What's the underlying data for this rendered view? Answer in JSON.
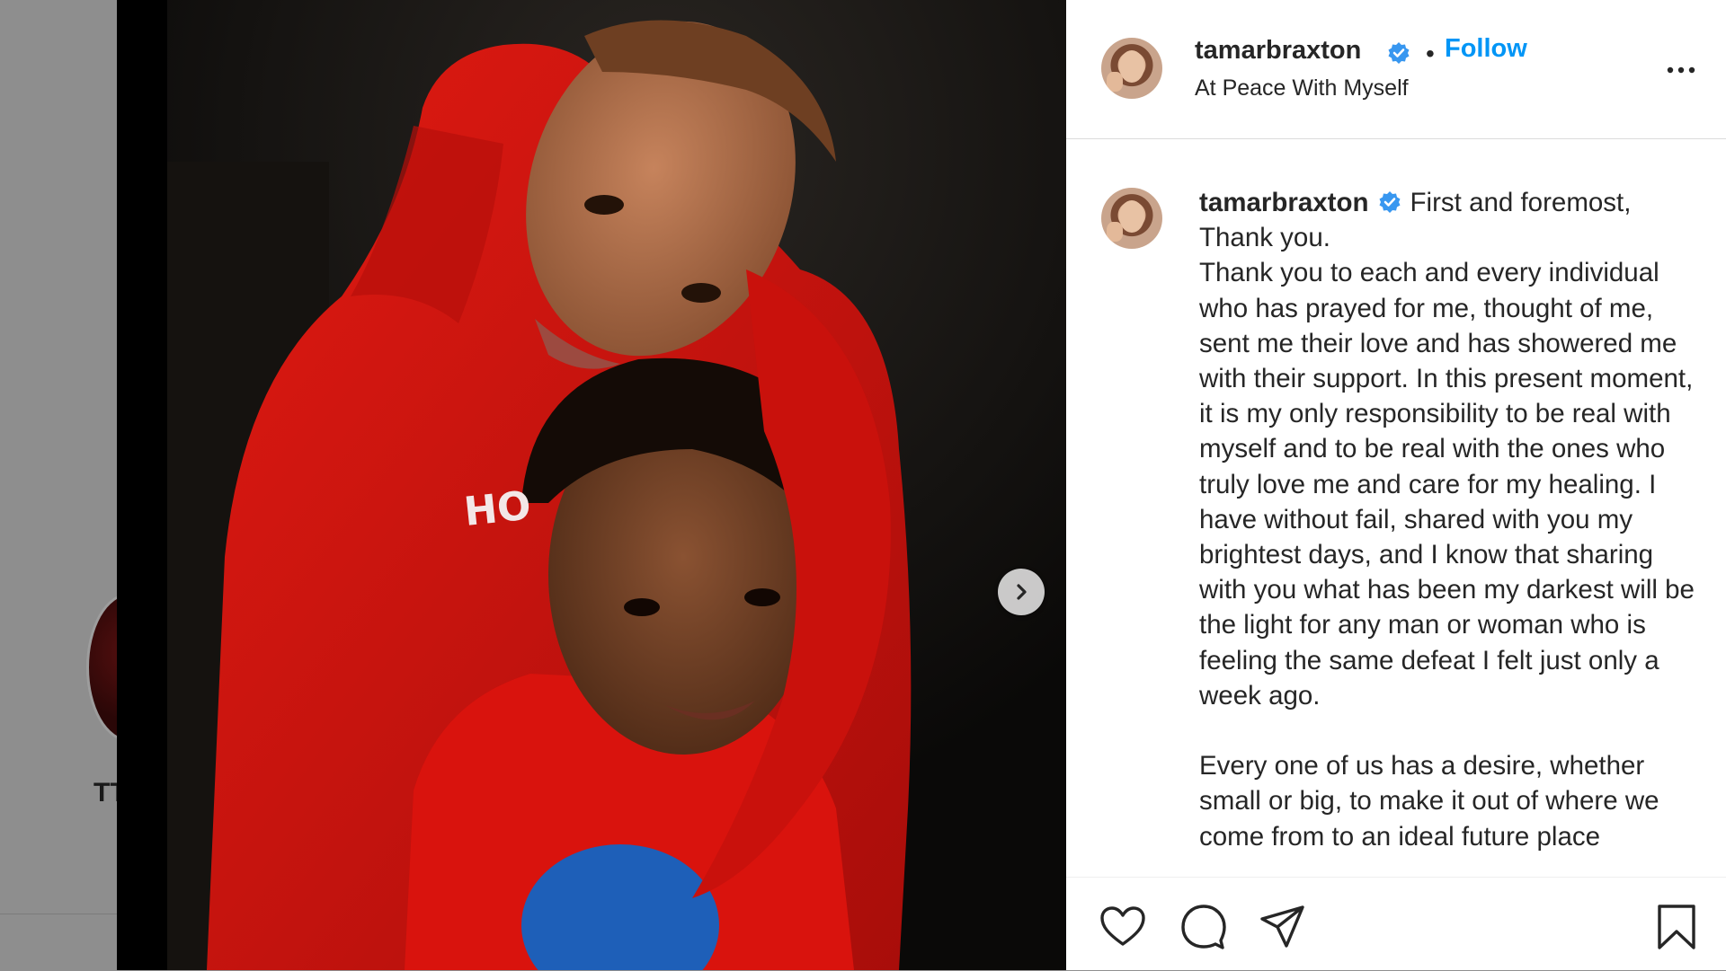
{
  "backdrop": {
    "partial_text": "TT"
  },
  "post": {
    "username": "tamarbraxton",
    "follow_label": "Follow",
    "separator": "•",
    "location": "At Peace With Myself",
    "verified_icon": "verified-badge-icon",
    "more_icon": "more-options-icon",
    "photo_shirt_text": "HO",
    "caption": {
      "text": "First and foremost,\nThank you.\nThank you to each and every individual who has prayed for me, thought of me, sent me their love and has showered me with their support. In this present moment, it is my only responsibility to be real with myself and to be real with the ones who truly love me and care for my healing. I have without fail, shared with you my brightest days, and I know that sharing with you what has been my darkest will be the light for any man or woman who is feeling the same defeat I felt just only a week ago.\n\nEvery one of us has a desire, whether small or big, to make it out of where we come from to an ideal future place"
    },
    "actions": [
      "heart-icon",
      "comment-icon",
      "share-icon",
      "bookmark-icon"
    ],
    "colors": {
      "accent": "#0095f6",
      "verified": "#3897f0",
      "text": "#262626",
      "hoodie": "#d8140f"
    }
  }
}
